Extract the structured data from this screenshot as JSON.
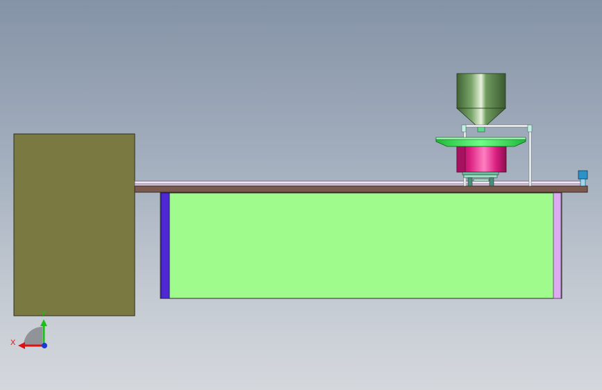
{
  "triad": {
    "x_label": "X",
    "y_label": "Y"
  },
  "colors": {
    "background_top": "#8593a7",
    "background_bottom": "#d4d8dd",
    "control_cabinet": "#7a7942",
    "frame_panel": "#9ffc8c",
    "frame_post_left": "#4f28d6",
    "frame_post_right": "#dcaaf0",
    "table_top": "#7a5a4e",
    "conveyor_rail": "#e9dcef",
    "hopper": "#4e7a42",
    "turntable": "#2ee84a",
    "bowl": "#e8238b",
    "sensor": "#2a93c9",
    "axis_x": "#e01010",
    "axis_y": "#18c018",
    "axis_z": "#1a3ad8"
  }
}
